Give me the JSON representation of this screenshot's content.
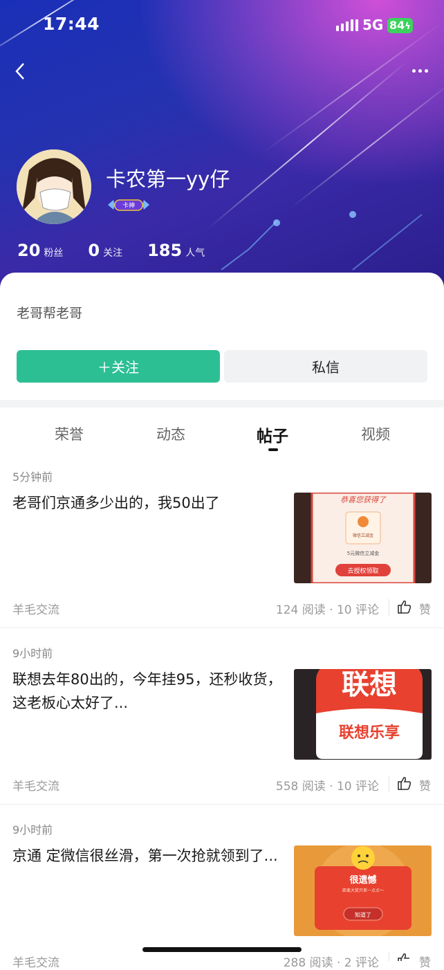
{
  "status_bar": {
    "time": "17:44",
    "network": "5G",
    "battery": "84"
  },
  "profile": {
    "name": "卡农第一yy仔",
    "badge": "卡神",
    "stats": [
      {
        "value": "20",
        "label": "粉丝"
      },
      {
        "value": "0",
        "label": "关注"
      },
      {
        "value": "185",
        "label": "人气"
      }
    ],
    "bio": "老哥帮老哥",
    "follow_label": "＋关注",
    "message_label": "私信"
  },
  "tabs": [
    "荣誉",
    "动态",
    "帖子",
    "视频"
  ],
  "active_tab": "帖子",
  "posts": [
    {
      "time": "5分钟前",
      "title": "老哥们京通多少出的，我50出了",
      "category": "羊毛交流",
      "meta": "124 阅读 · 10 评论",
      "like_label": "赞",
      "thumb": {
        "header": "恭喜您获得了",
        "card": "微信立减金",
        "sub": "5元微信立减金",
        "button": "去授权领取"
      }
    },
    {
      "time": "9小时前",
      "title": "联想去年80出的，今年挂95，还秒收货，这老板心太好了...",
      "category": "羊毛交流",
      "meta": "558 阅读 · 10 评论",
      "like_label": "赞",
      "thumb": {
        "big": "联想",
        "sub": "联想乐享"
      }
    },
    {
      "time": "9小时前",
      "title": "京通   定微信很丝滑，第一次抢就领到了...",
      "category": "羊毛交流",
      "meta": "288 阅读 · 2 评论",
      "like_label": "赞",
      "thumb": {
        "header": "很遗憾",
        "sub": "距离大奖只差一点点～",
        "button": "知道了"
      }
    }
  ],
  "colors": {
    "accent": "#2dbf94",
    "header_start": "#1a2fb8",
    "header_end": "#d04fd8"
  }
}
